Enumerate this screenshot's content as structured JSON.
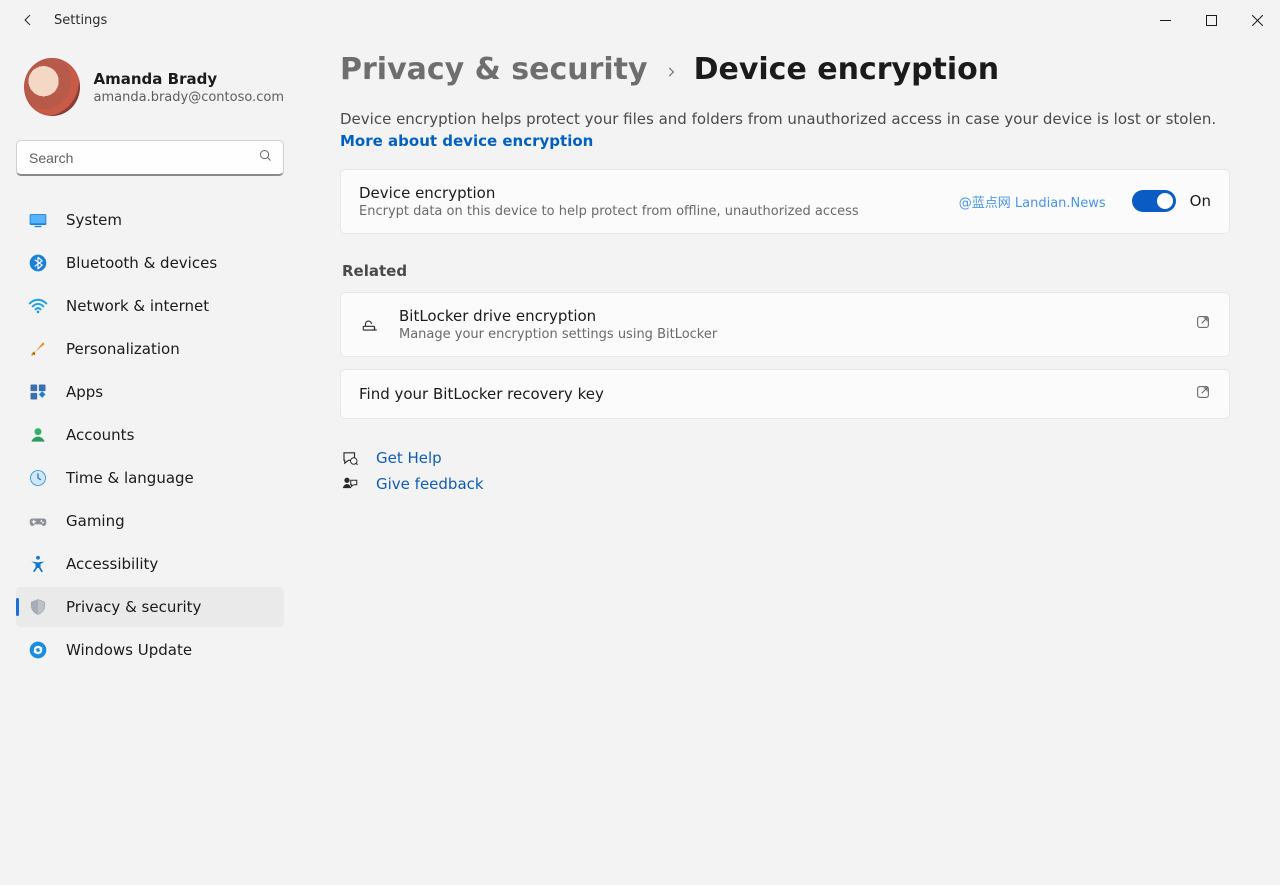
{
  "window": {
    "title": "Settings"
  },
  "profile": {
    "name": "Amanda Brady",
    "email": "amanda.brady@contoso.com"
  },
  "search": {
    "placeholder": "Search"
  },
  "sidebar": {
    "items": [
      {
        "label": "System"
      },
      {
        "label": "Bluetooth & devices"
      },
      {
        "label": "Network & internet"
      },
      {
        "label": "Personalization"
      },
      {
        "label": "Apps"
      },
      {
        "label": "Accounts"
      },
      {
        "label": "Time & language"
      },
      {
        "label": "Gaming"
      },
      {
        "label": "Accessibility"
      },
      {
        "label": "Privacy & security"
      },
      {
        "label": "Windows Update"
      }
    ]
  },
  "breadcrumb": {
    "parent": "Privacy & security",
    "current": "Device encryption"
  },
  "main": {
    "intro_text": "Device encryption helps protect your files and folders from unauthorized access in case your device is lost or stolen. ",
    "intro_link": "More about device encryption",
    "device_encryption": {
      "title": "Device encryption",
      "subtitle": "Encrypt data on this device to help protect from offline, unauthorized access",
      "watermark": "@蓝点网 Landian.News",
      "toggle_label": "On"
    },
    "related_label": "Related",
    "bitlocker": {
      "title": "BitLocker drive encryption",
      "subtitle": "Manage your encryption settings using BitLocker"
    },
    "recovery": {
      "title": "Find your BitLocker recovery key"
    },
    "help": {
      "label": "Get Help"
    },
    "feedback": {
      "label": "Give feedback"
    }
  }
}
